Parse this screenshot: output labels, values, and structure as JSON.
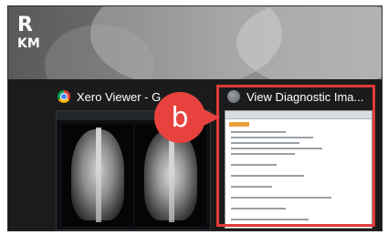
{
  "overlay": {
    "marker_r": "R",
    "marker_km": "KM"
  },
  "taskbar": {
    "thumbnails": [
      {
        "title": "Xero Viewer - G",
        "icon": "chrome-icon"
      },
      {
        "title": "View Diagnostic Ima...",
        "icon": "app-icon"
      }
    ]
  },
  "callout": {
    "label": "b"
  },
  "colors": {
    "callout": "#e8423f",
    "highlight_border": "#e03a3a"
  }
}
